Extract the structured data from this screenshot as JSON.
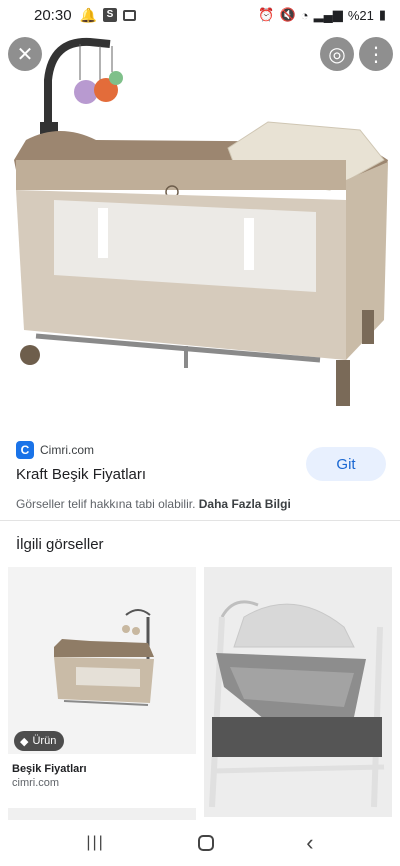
{
  "status": {
    "time": "20:30",
    "battery": "%21"
  },
  "result": {
    "source_favicon": "C",
    "source_name": "Cimri.com",
    "title": "Kraft Beşik Fiyatları",
    "visit_label": "Git",
    "copyright_text": "Görseller telif hakkına tabi olabilir.",
    "more_info_label": "Daha Fazla Bilgi"
  },
  "related": {
    "heading": "İlgili görseller",
    "cards": [
      {
        "badge": "Ürün",
        "title": "Beşik Fiyatları",
        "source": "cimri.com"
      },
      {
        "badge": "",
        "title": "",
        "source": ""
      }
    ]
  },
  "icons": {
    "close": "close-icon",
    "lens": "lens-icon",
    "more": "more-vert-icon",
    "badge": "tag-icon"
  },
  "colors": {
    "accent": "#1a73e8",
    "visit_bg": "#e8f0fe",
    "visit_text": "#1967d2",
    "overlay_button": "#8f8f8f"
  }
}
